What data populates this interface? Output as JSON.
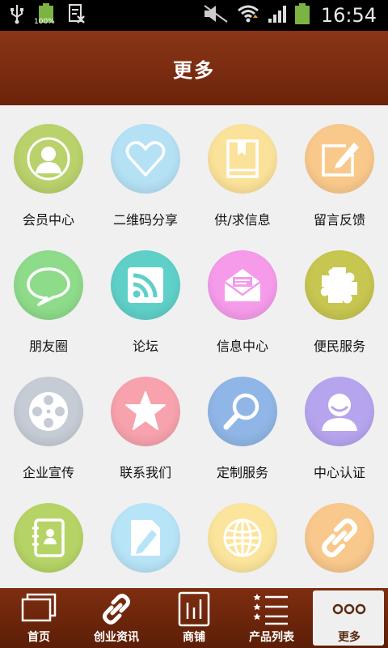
{
  "status_bar": {
    "battery_level": "100%",
    "time": "16:54"
  },
  "header": {
    "title": "更多"
  },
  "grid": {
    "items": [
      {
        "label": "会员中心",
        "color": "#b9d26c",
        "icon": "user-icon"
      },
      {
        "label": "二维码分享",
        "color": "#b5e1f5",
        "icon": "heart-icon"
      },
      {
        "label": "供/求信息",
        "color": "#fbe29a",
        "icon": "book-icon"
      },
      {
        "label": "留言反馈",
        "color": "#f9c98c",
        "icon": "pencil-note-icon"
      },
      {
        "label": "朋友圈",
        "color": "#8edb8a",
        "icon": "speech-bubble-icon"
      },
      {
        "label": "论坛",
        "color": "#5fd0c8",
        "icon": "rss-icon"
      },
      {
        "label": "信息中心",
        "color": "#f59bea",
        "icon": "envelope-icon"
      },
      {
        "label": "便民服务",
        "color": "#c7c650",
        "icon": "puzzle-icon"
      },
      {
        "label": "企业宣传",
        "color": "#c6ccd5",
        "icon": "film-reel-icon"
      },
      {
        "label": "联系我们",
        "color": "#f7a2ad",
        "icon": "star-icon"
      },
      {
        "label": "定制服务",
        "color": "#8fb6e6",
        "icon": "magnifier-icon"
      },
      {
        "label": "中心认证",
        "color": "#b7a4ef",
        "icon": "profile-icon"
      },
      {
        "label": "",
        "color": "#b6d466",
        "icon": "address-book-icon"
      },
      {
        "label": "",
        "color": "#b7e4f7",
        "icon": "document-edit-icon"
      },
      {
        "label": "",
        "color": "#fbe59c",
        "icon": "globe-icon"
      },
      {
        "label": "",
        "color": "#f8c88c",
        "icon": "link-icon"
      }
    ]
  },
  "tabbar": {
    "tabs": [
      {
        "label": "首页",
        "icon": "windows-icon"
      },
      {
        "label": "创业资讯",
        "icon": "link-icon"
      },
      {
        "label": "商铺",
        "icon": "bar-chart-icon"
      },
      {
        "label": "产品列表",
        "icon": "list-icon"
      },
      {
        "label": "更多",
        "icon": "more-dots-icon",
        "active": true
      }
    ]
  }
}
